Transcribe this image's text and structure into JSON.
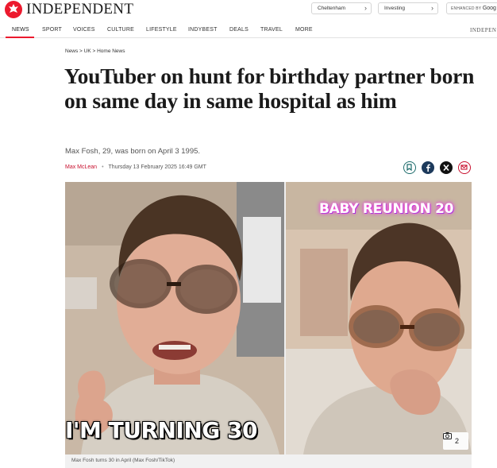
{
  "site": {
    "brand": "INDEPENDENT",
    "accent_color": "#ec1a2e",
    "pills": [
      {
        "label": "Cheltenham"
      },
      {
        "label": "Investing"
      }
    ],
    "search_prefix": "ENHANCED BY",
    "search_brand": "Goog"
  },
  "nav": {
    "items": [
      "NEWS",
      "SPORT",
      "VOICES",
      "CULTURE",
      "LIFESTYLE",
      "INDYBEST",
      "DEALS",
      "TRAVEL",
      "MORE"
    ],
    "active": "NEWS",
    "brand_short": "INDEPEN"
  },
  "article": {
    "breadcrumb": "News > UK > Home News",
    "headline": "YouTuber on hunt for birthday partner born on same day in same hospital as him",
    "standfirst": "Max Fosh, 29, was born on April 3 1995.",
    "author": "Max McLean",
    "separator": "•",
    "date": "Thursday 13 February 2025 16:49 GMT",
    "share_icons": [
      "bookmark-icon",
      "facebook-icon",
      "x-icon",
      "email-icon"
    ]
  },
  "media": {
    "left_overlay_text": "I'M TURNING 30",
    "right_overlay_text": "BABY REUNION 20",
    "gallery_count": "2",
    "caption": "Max Fosh turns 30 in April (Max Fosh/TikTok)"
  }
}
